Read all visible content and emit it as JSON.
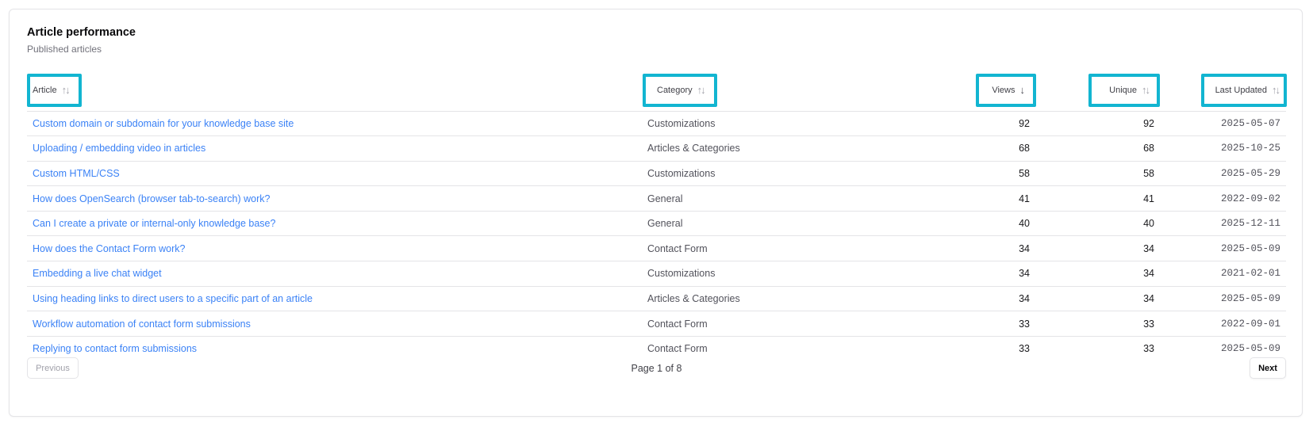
{
  "card": {
    "title": "Article performance",
    "subtitle": "Published articles"
  },
  "table": {
    "columns": [
      {
        "label": "Article",
        "sort_icon": "sort-both-icon"
      },
      {
        "label": "Category",
        "sort_icon": "sort-both-icon"
      },
      {
        "label": "Views",
        "sort_icon": "sort-desc-icon"
      },
      {
        "label": "Unique",
        "sort_icon": "sort-both-icon"
      },
      {
        "label": "Last Updated",
        "sort_icon": "sort-both-icon"
      }
    ],
    "rows": [
      {
        "article": "Custom domain or subdomain for your knowledge base site",
        "category": "Customizations",
        "views": "92",
        "unique": "92",
        "updated": "2025-05-07"
      },
      {
        "article": "Uploading / embedding video in articles",
        "category": "Articles & Categories",
        "views": "68",
        "unique": "68",
        "updated": "2025-10-25"
      },
      {
        "article": "Custom HTML/CSS",
        "category": "Customizations",
        "views": "58",
        "unique": "58",
        "updated": "2025-05-29"
      },
      {
        "article": "How does OpenSearch (browser tab-to-search) work?",
        "category": "General",
        "views": "41",
        "unique": "41",
        "updated": "2022-09-02"
      },
      {
        "article": "Can I create a private or internal-only knowledge base?",
        "category": "General",
        "views": "40",
        "unique": "40",
        "updated": "2025-12-11"
      },
      {
        "article": "How does the Contact Form work?",
        "category": "Contact Form",
        "views": "34",
        "unique": "34",
        "updated": "2025-05-09"
      },
      {
        "article": "Embedding a live chat widget",
        "category": "Customizations",
        "views": "34",
        "unique": "34",
        "updated": "2021-02-01"
      },
      {
        "article": "Using heading links to direct users to a specific part of an article",
        "category": "Articles & Categories",
        "views": "34",
        "unique": "34",
        "updated": "2025-05-09"
      },
      {
        "article": "Workflow automation of contact form submissions",
        "category": "Contact Form",
        "views": "33",
        "unique": "33",
        "updated": "2022-09-01"
      },
      {
        "article": "Replying to contact form submissions",
        "category": "Contact Form",
        "views": "33",
        "unique": "33",
        "updated": "2025-05-09"
      }
    ]
  },
  "pagination": {
    "previous_label": "Previous",
    "page_info": "Page 1 of 8",
    "next_label": "Next"
  },
  "colors": {
    "link": "#3b82f6",
    "highlight_border": "#12b5d1",
    "border": "#e4e4e7",
    "muted_text": "#71717a"
  }
}
